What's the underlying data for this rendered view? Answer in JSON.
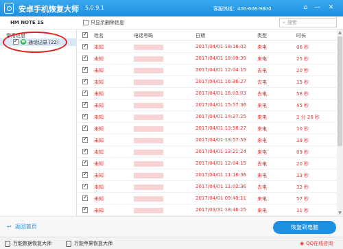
{
  "app": {
    "title": "安卓手机恢复大师",
    "version": "5.0.9.1",
    "hotline": "客服热线：400-606-9600"
  },
  "toolbar": {
    "device": "HM NOTE 1S",
    "filter_label": "只显示删除信息",
    "search_placeholder": "搜索"
  },
  "sidebar": {
    "root": "常用信息",
    "item": "通话记录 (22)"
  },
  "table": {
    "headers": [
      "姓名",
      "电话号码",
      "日期",
      "类型",
      "时长"
    ],
    "rows": [
      {
        "name": "未知",
        "phone": "",
        "date": "2017/04/01 18:16:02",
        "type": "来电",
        "duration": "06 秒"
      },
      {
        "name": "未知",
        "phone": "",
        "date": "2017/04/01 18:09:39",
        "type": "来电",
        "duration": "25 秒"
      },
      {
        "name": "未知",
        "phone": "",
        "date": "2017/04/01 12:04:15",
        "type": "去电",
        "duration": "20 秒"
      },
      {
        "name": "未知",
        "phone": "",
        "date": "2017/04/01 16:36:27",
        "type": "去电",
        "duration": "15 秒"
      },
      {
        "name": "未知",
        "phone": "",
        "date": "2017/04/01 16:03:03",
        "type": "去电",
        "duration": "58 秒"
      },
      {
        "name": "未知",
        "phone": "",
        "date": "2017/04/01 15:57:36",
        "type": "来电",
        "duration": "45 秒"
      },
      {
        "name": "未知",
        "phone": "",
        "date": "2017/04/01 14:37:25",
        "type": "来电",
        "duration": "1 分 26 秒"
      },
      {
        "name": "未知",
        "phone": "",
        "date": "2017/04/01 13:58:27",
        "type": "来电",
        "duration": "10 秒"
      },
      {
        "name": "未知",
        "phone": "",
        "date": "2017/04/01 13:57:59",
        "type": "来电",
        "duration": "19 秒"
      },
      {
        "name": "未知",
        "phone": "",
        "date": "2017/04/01 13:21:24",
        "type": "来电",
        "duration": "09 秒"
      },
      {
        "name": "未知",
        "phone": "",
        "date": "2017/04/01 12:04:15",
        "type": "去电",
        "duration": "20 秒"
      },
      {
        "name": "未知",
        "phone": "",
        "date": "2017/04/01 11:16:36",
        "type": "来电",
        "duration": "13 秒"
      },
      {
        "name": "未知",
        "phone": "",
        "date": "2017/04/01 11:02:36",
        "type": "去电",
        "duration": "32 秒"
      },
      {
        "name": "未知",
        "phone": "",
        "date": "2017/04/01 09:49:11",
        "type": "来电",
        "duration": "57 秒"
      },
      {
        "name": "未知",
        "phone": "",
        "date": "2017/03/31 18:46:25",
        "type": "来电",
        "duration": "11 秒"
      }
    ]
  },
  "footer": {
    "back_label": "返回首页",
    "restore_label": "恢复到电脑"
  },
  "bottombar": {
    "link1": "万能数据恢复大师",
    "link2": "万能苹果恢复大师",
    "qq": "QQ在线咨询"
  },
  "colors": {
    "accent": "#1d8fe0",
    "deleted": "#e23030"
  }
}
